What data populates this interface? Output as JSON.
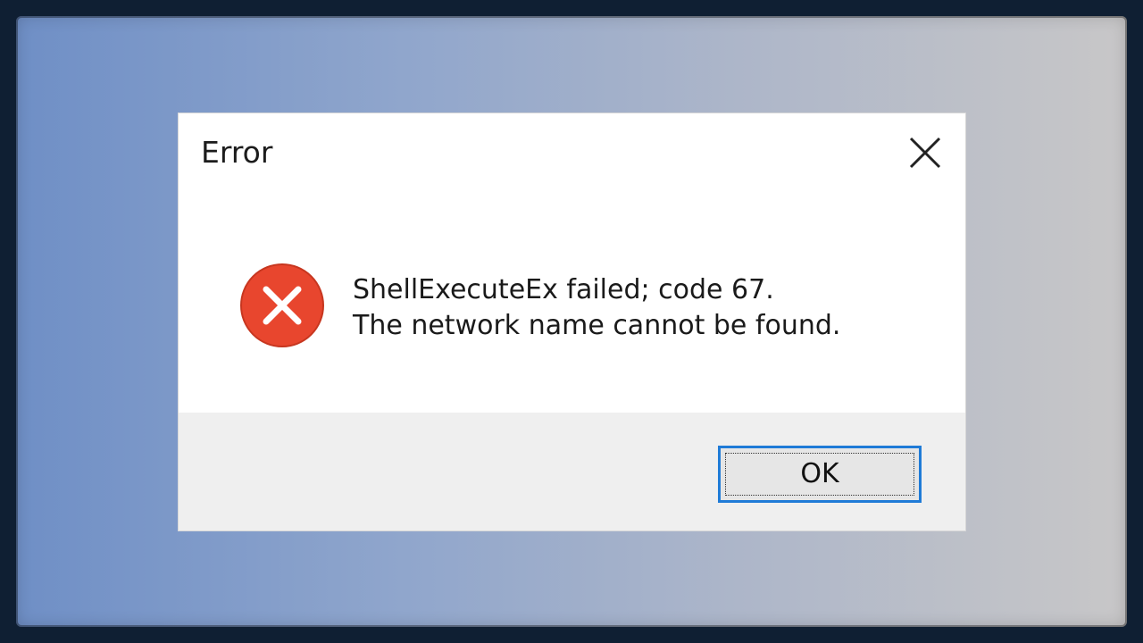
{
  "dialog": {
    "title": "Error",
    "message_line1": "ShellExecuteEx failed; code 67.",
    "message_line2": "The network name cannot be found.",
    "ok_label": "OK",
    "icons": {
      "close": "close-icon",
      "error": "error-icon"
    }
  },
  "colors": {
    "error_red": "#e8462e",
    "focus_blue": "#1f7bd7",
    "footer_gray": "#efefef"
  }
}
